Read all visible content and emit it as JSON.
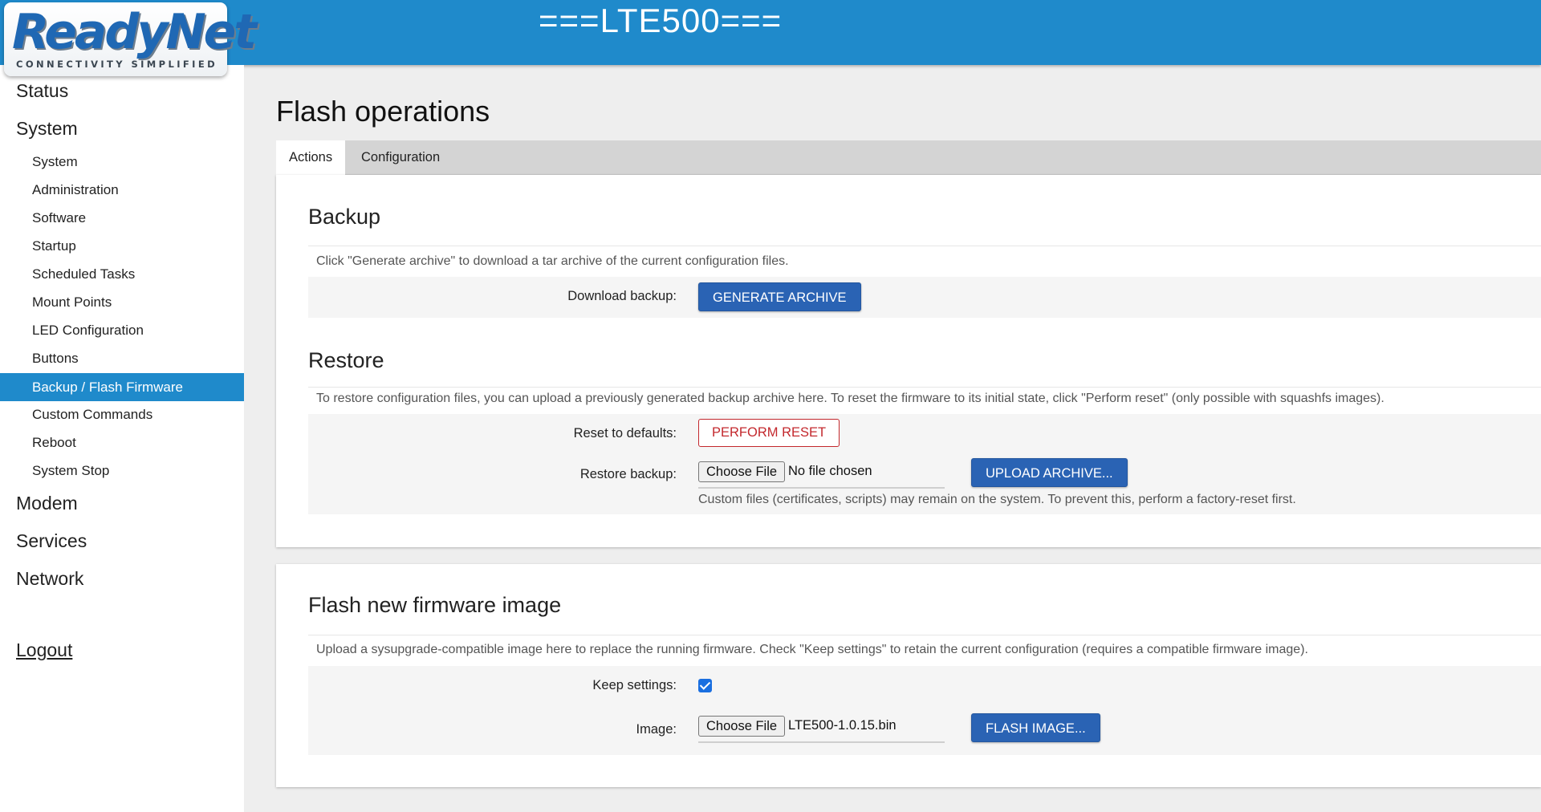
{
  "header": {
    "title": "===LTE500===",
    "logo_text": "ReadyNet",
    "logo_tagline": "CONNECTIVITY SIMPLIFIED"
  },
  "sidebar": {
    "status": "Status",
    "system": "System",
    "items": [
      {
        "label": "System"
      },
      {
        "label": "Administration"
      },
      {
        "label": "Software"
      },
      {
        "label": "Startup"
      },
      {
        "label": "Scheduled Tasks"
      },
      {
        "label": "Mount Points"
      },
      {
        "label": "LED Configuration"
      },
      {
        "label": "Buttons"
      },
      {
        "label": "Backup / Flash Firmware"
      },
      {
        "label": "Custom Commands"
      },
      {
        "label": "Reboot"
      },
      {
        "label": "System Stop"
      }
    ],
    "active_item": "Backup / Flash Firmware",
    "modem": "Modem",
    "services": "Services",
    "network": "Network",
    "logout": "Logout"
  },
  "main": {
    "title": "Flash operations",
    "tabs": [
      {
        "label": "Actions",
        "active": true
      },
      {
        "label": "Configuration",
        "active": false
      }
    ],
    "backup": {
      "title": "Backup",
      "description": "Click \"Generate archive\" to download a tar archive of the current configuration files.",
      "download_label": "Download backup:",
      "generate_button": "GENERATE ARCHIVE"
    },
    "restore": {
      "title": "Restore",
      "description": "To restore configuration files, you can upload a previously generated backup archive here. To reset the firmware to its initial state, click \"Perform reset\" (only possible with squashfs images).",
      "reset_label": "Reset to defaults:",
      "reset_button": "PERFORM RESET",
      "restore_label": "Restore backup:",
      "choose_file": "Choose File",
      "file_value": "No file chosen",
      "upload_button": "UPLOAD ARCHIVE...",
      "note": "Custom files (certificates, scripts) may remain on the system. To prevent this, perform a factory-reset first."
    },
    "flash": {
      "title": "Flash new firmware image",
      "description": "Upload a sysupgrade-compatible image here to replace the running firmware. Check \"Keep settings\" to retain the current configuration (requires a compatible firmware image).",
      "keep_label": "Keep settings:",
      "keep_checked": true,
      "image_label": "Image:",
      "choose_file": "Choose File",
      "file_value": "LTE500-1.0.15.bin",
      "flash_button": "FLASH IMAGE..."
    }
  },
  "colors": {
    "header_bg": "#1f8acb",
    "active_nav_bg": "#1f8acb",
    "primary_button": "#2a63b4",
    "danger": "#c3282d",
    "checkbox": "#1a6fe0"
  }
}
